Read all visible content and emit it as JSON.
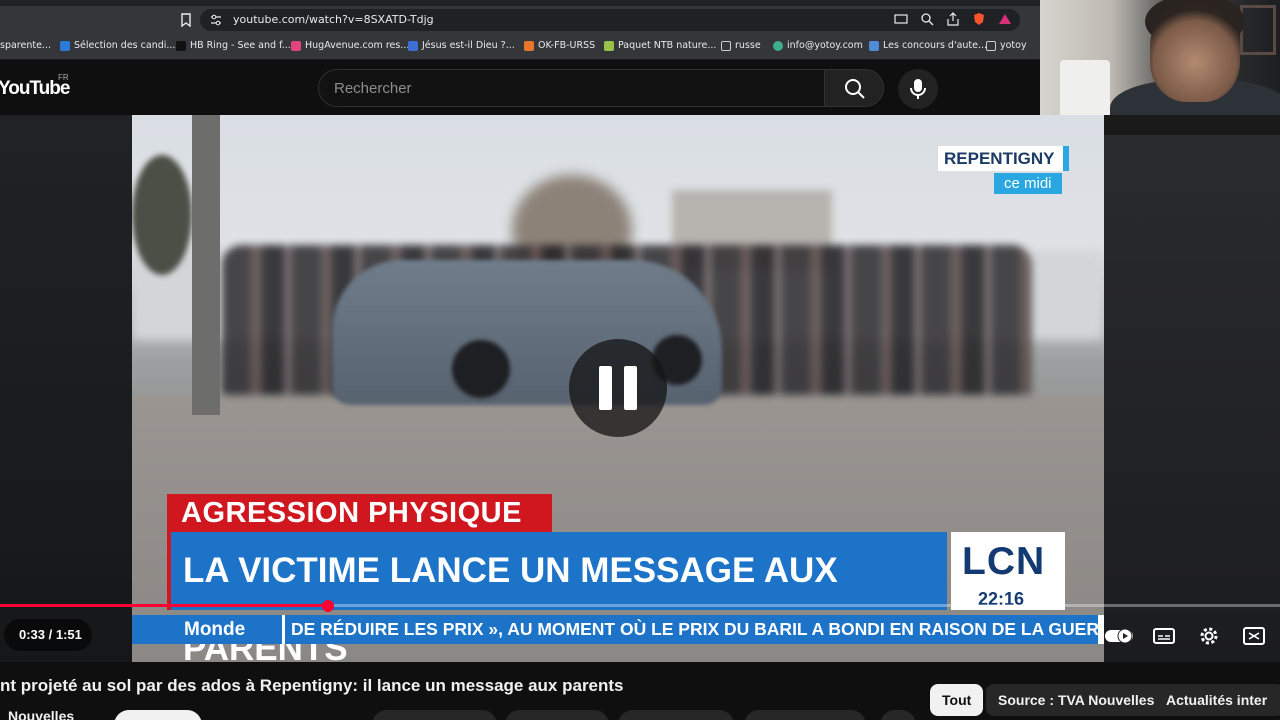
{
  "browser": {
    "url": "youtube.com/watch?v=8SXATD-Tdjg",
    "bookmarks": [
      {
        "label": "sparente...",
        "color": "#c8c8c8"
      },
      {
        "label": "Sélection des candi...",
        "color": "#2a7bd8"
      },
      {
        "label": "HB Ring - See and f...",
        "color": "#111111"
      },
      {
        "label": "HugAvenue.com res...",
        "color": "#e0457b"
      },
      {
        "label": "Jésus est-il Dieu ?...",
        "color": "#3b6fd1"
      },
      {
        "label": "OK-FB-URSS",
        "color": "#e7762a"
      },
      {
        "label": "Paquet NTB nature...",
        "color": "#97c24a"
      },
      {
        "label": "russe",
        "color": "#cccccc"
      },
      {
        "label": "info@yotoy.com",
        "color": "#3fae8b"
      },
      {
        "label": "Les concours d'aute...",
        "color": "#4f8bd6"
      },
      {
        "label": "yotoy",
        "color": "#cccccc"
      }
    ]
  },
  "youtube": {
    "logo": "YouTube",
    "region": "FR",
    "search_placeholder": "Rechercher"
  },
  "video": {
    "location_line1": "REPENTIGNY",
    "location_line2": "ce midi",
    "banner_top": "AGRESSION PHYSIQUE",
    "banner_main": "LA VICTIME LANCE UN MESSAGE AUX PARENTS",
    "channel_logo": "LCN",
    "clock": "22:16",
    "ticker_category": "Monde",
    "ticker_text": "DE RÉDUIRE LES PRIX », AU MOMENT OÙ LE PRIX DU BARIL A BONDI EN RAISON DE LA GUER",
    "time_display": "0:33 / 1:51",
    "progress_fraction": 0.297
  },
  "page": {
    "title": "nt projeté au sol par des ados à Repentigny: il lance un message aux parents",
    "channel": "Nouvelles",
    "chips": [
      {
        "label": "Tout",
        "active": true
      },
      {
        "label": "Source : TVA Nouvelles",
        "active": false
      },
      {
        "label": "Actualités inter",
        "active": false
      }
    ]
  },
  "colors": {
    "progress": "#ff0033",
    "lcn_red": "#d0161f",
    "lcn_blue": "#1c73c8"
  }
}
